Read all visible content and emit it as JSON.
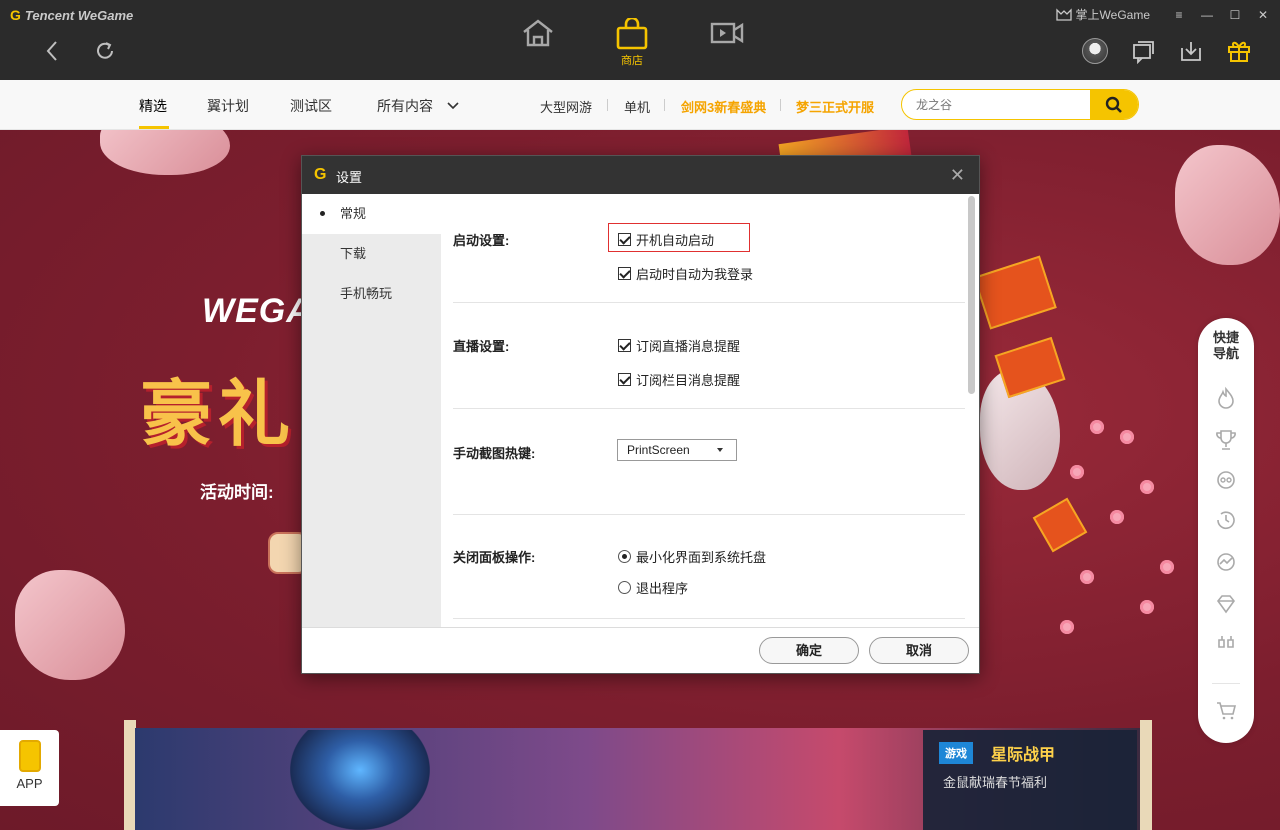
{
  "app": {
    "logo_text": "Tencent WeGame"
  },
  "window": {
    "remote_label": "掌上WeGame",
    "minimize": "—",
    "maximize": "☐",
    "close": "✕"
  },
  "main_nav": {
    "store_label": "商店"
  },
  "sub_nav": {
    "tabs": [
      "精选",
      "翼计划",
      "测试区",
      "所有内容"
    ],
    "links": [
      "大型网游",
      "单机",
      "剑网3新春盛典",
      "梦三正式开服"
    ],
    "search_placeholder": "龙之谷"
  },
  "banner": {
    "brand": "WEGA",
    "headline": "豪礼",
    "time_text": "活动时间:"
  },
  "lower_banner": {
    "tag": "游戏",
    "game_title": "星际战甲",
    "subtitle": "金鼠献瑞春节福利"
  },
  "app_badge": {
    "label": "APP"
  },
  "quick_nav": {
    "title_line1": "快捷",
    "title_line2": "导航"
  },
  "dialog": {
    "title": "设置",
    "sidebar": [
      "常规",
      "下载",
      "手机畅玩"
    ],
    "sections": {
      "startup": {
        "label": "启动设置:",
        "options": [
          {
            "text": "开机自动启动",
            "checked": true
          },
          {
            "text": "启动时自动为我登录",
            "checked": true
          }
        ]
      },
      "live": {
        "label": "直播设置:",
        "options": [
          {
            "text": "订阅直播消息提醒",
            "checked": true
          },
          {
            "text": "订阅栏目消息提醒",
            "checked": true
          }
        ]
      },
      "screenshot": {
        "label": "手动截图热键:",
        "value": "PrintScreen"
      },
      "close_panel": {
        "label": "关闭面板操作:",
        "options": [
          {
            "text": "最小化界面到系统托盘",
            "selected": true
          },
          {
            "text": "退出程序",
            "selected": false
          }
        ]
      }
    },
    "ok_label": "确定",
    "cancel_label": "取消"
  },
  "colors": {
    "accent": "#f5c400",
    "topbar": "#2b2b2b",
    "banner": "#7c1e2e"
  }
}
